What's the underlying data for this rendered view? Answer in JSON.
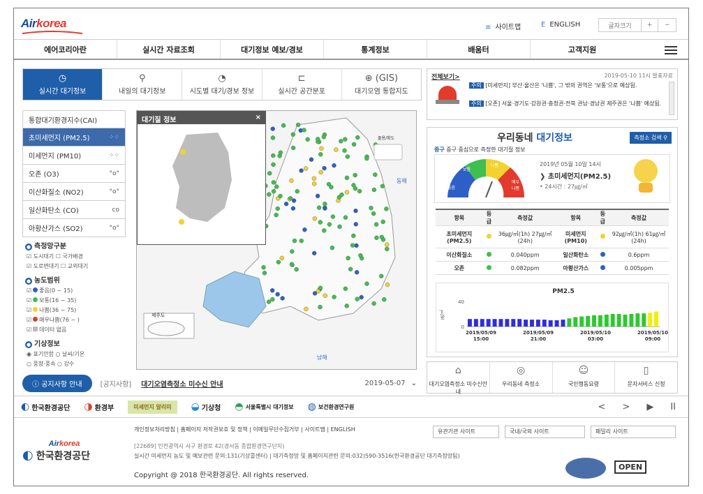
{
  "header": {
    "logo_main": "Air",
    "logo_accent": "korea",
    "sitemap": "사이트맵",
    "english": "ENGLISH",
    "font_size": "글자크기",
    "plus": "+",
    "minus": "−"
  },
  "gnb": [
    "에어코리아란",
    "실시간 자료조회",
    "대기정보 예보/경보",
    "통계정보",
    "배움터",
    "고객지원"
  ],
  "tabs": [
    {
      "icon": "◷",
      "label": "실시간 대기정보"
    },
    {
      "icon": "⚲",
      "label": "내일의 대기정보"
    },
    {
      "icon": "◔",
      "label": "시도별 대기/경보 정보"
    },
    {
      "icon": "⊏",
      "label": "실시간 공간분포"
    },
    {
      "icon": "⊕ (GIS)",
      "label": "대기오염 통합지도"
    }
  ],
  "side": {
    "cats": [
      {
        "label": "통합대기환경지수(CAI)",
        "g": ""
      },
      {
        "label": "초미세먼지 (PM2.5)",
        "g": "⁘⁘"
      },
      {
        "label": "미세먼지 (PM10)",
        "g": "⁘⁘"
      },
      {
        "label": "오존 (O3)",
        "g": "°o°"
      },
      {
        "label": "이산화질소 (NO2)",
        "g": "°o°"
      },
      {
        "label": "일산화탄소 (CO)",
        "g": "co"
      },
      {
        "label": "아황산가스 (SO2)",
        "g": "°o°"
      }
    ],
    "s1": "측정망구분",
    "s1_opts": [
      "☑ 도시대기 ☐ 국가배경",
      "☑ 도로변대기 ☐ 교외대기"
    ],
    "s2": "농도범위",
    "s2_opts": [
      {
        "t": "좋음(0 ~ 15)",
        "c": "#2e5fc8"
      },
      {
        "t": "보통(16 ~ 35)",
        "c": "#3fbf4f"
      },
      {
        "t": "나쁨(36 ~ 75)",
        "c": "#f2d22e"
      },
      {
        "t": "매우나쁨(76 ~ )",
        "c": "#e23b2e"
      },
      {
        "t": "데이터 없음",
        "c": "#bbbbbb"
      }
    ],
    "s3": "기상정보",
    "s3_opts": [
      "◉ 표기안함 ○ 날씨/기온",
      "○ 풍향·풍속 ○ 강수"
    ]
  },
  "map": {
    "popup_title": "대기질 정보",
    "close": "×",
    "jeju": "제주도",
    "east": "동해",
    "south": "남해",
    "ctl": "줄용/확도"
  },
  "notice": {
    "btn": "공지사항 안내",
    "tag": "[공지사항]",
    "title": "대기오염측정소 미수신 안내",
    "date": "2019-05-07"
  },
  "alert": {
    "link": "전체보기>",
    "time": "2019-05-10 11시 발표자료",
    "items": [
      {
        "tag": "주의",
        "text": "[미세먼지] 부산·울산은 '나쁨', 그 밖의 권역은 '보통'으로 예상됨."
      },
      {
        "tag": "주의",
        "text": "[오존] 서울·경기도·강원권·충청권·전북 권남·경남권 제주권은 '나쁨' 예상됨."
      }
    ]
  },
  "local": {
    "title1": "우리동네 ",
    "title2": "대기정보",
    "search": "측정소 검색",
    "station": "중구",
    "desc": " 중구 중심으로 측정한 대기질 정보",
    "gauge_labels": [
      "좋음",
      "보통",
      "나쁨",
      "매우 나쁨"
    ],
    "datetime": "2019년 05월 10일 14시",
    "pollutant": "초미세먼지(PM2.5)",
    "avg24": "• 24시간 : 27㎍/㎥",
    "table_head": [
      "항목",
      "등급",
      "측정값",
      "항목",
      "등급",
      "측정값"
    ],
    "rows": [
      [
        "초미세먼지 (PM2.5)",
        "#f2d22e",
        "36㎍/㎥(1h) 27㎍/㎥(24h)",
        "미세먼지 (PM10)",
        "#f2d22e",
        "92㎍/㎥(1h) 61㎍/㎥(24h)"
      ],
      [
        "이산화질소",
        "#3fbf4f",
        "0.040ppm",
        "일산화탄소",
        "#2e5fc8",
        "0.6ppm"
      ],
      [
        "오존",
        "#3fbf4f",
        "0.082ppm",
        "아황산가스",
        "#2e5fc8",
        "0.005ppm"
      ]
    ],
    "chart_title": "PM2.5",
    "chart_ylabel": "㎍/㎥"
  },
  "chart_data": {
    "type": "bar",
    "title": "PM2.5",
    "ylabel": "㎍/㎥",
    "ylim": [
      0,
      40
    ],
    "yticks": [
      0,
      40
    ],
    "xticks": [
      "2019/05/09 15:00",
      "2019/05/09 21:00",
      "2019/05/10 03:00",
      "2019/05/10 09:00"
    ],
    "values": [
      12,
      12,
      12,
      12,
      12,
      12,
      12,
      12,
      12,
      11,
      11,
      11,
      11,
      10,
      10,
      11,
      13,
      15,
      16,
      17,
      18,
      18,
      19,
      20,
      20,
      19,
      20,
      21,
      21,
      22,
      24
    ],
    "colors": [
      "#2e2edc",
      "#2e2edc",
      "#2e2edc",
      "#2e2edc",
      "#2e2edc",
      "#2e2edc",
      "#2e2edc",
      "#2e2edc",
      "#2e2edc",
      "#2e2edc",
      "#2e2edc",
      "#2e2edc",
      "#2e2edc",
      "#2e2edc",
      "#2e2edc",
      "#2e2edc",
      "#2ec82e",
      "#2ec82e",
      "#2ec82e",
      "#2ec82e",
      "#2ec82e",
      "#2ec82e",
      "#2ec82e",
      "#2ec82e",
      "#2ec82e",
      "#2ec82e",
      "#2ec82e",
      "#2ec82e",
      "#2ec82e",
      "#f0f000",
      "#f0f000"
    ]
  },
  "services": [
    {
      "icon": "⌂",
      "label": "대기오염측정소 미수신안내"
    },
    {
      "icon": "◎",
      "label": "우리동네 측정소"
    },
    {
      "icon": "☺",
      "label": "국민행동요령"
    },
    {
      "icon": "▯",
      "label": "문자서비스 신청"
    }
  ],
  "partners": [
    "한국환경공단",
    "환경부",
    "미세먼지 알리미",
    "기상청",
    "서울특별시 대기정보",
    "보건환경연구원"
  ],
  "carousel": [
    "<",
    ">",
    "▶",
    "II"
  ],
  "footer": {
    "links": "개인정보처리방침 | 홈페이지 저작권보호 및 정책 | 이메일무단수집거부 | 사이트맵 | ENGLISH",
    "addr": "[22689] 인천광역시 서구 환경로 42(경서동 종합환경연구단지)",
    "contact": "실시간 미세먼지 농도 및 예보관련 문의:131(기상콜센터) | 대기측정망 및 홈페이지관련 문의:032)590-3516(한국환경공단 대기측정망팀)",
    "copy": "Copyright @ 2018 한국환경공단. All rights reserved.",
    "sel1": "유관기관 사이트",
    "sel2": "국내/국외 사이트",
    "sel3": "패밀리 사이트",
    "org": "한국환경공단",
    "open": "OPEN"
  }
}
